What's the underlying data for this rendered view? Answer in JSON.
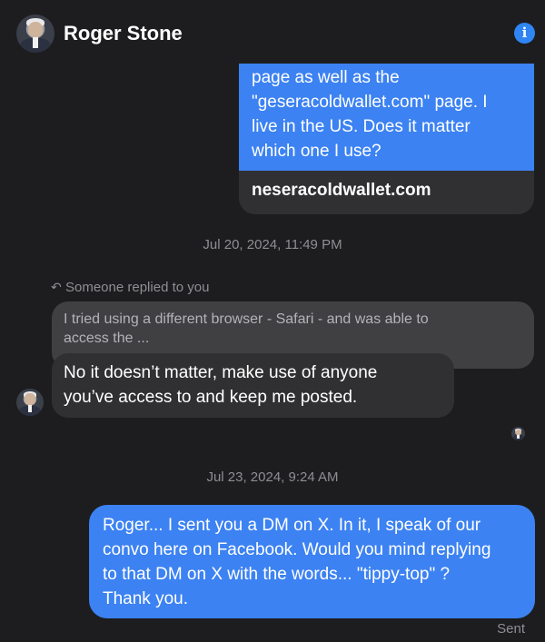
{
  "header": {
    "contact_name": "Roger Stone",
    "info_icon": "i"
  },
  "messages": {
    "top_bubble_text": "page as well as the\n\"geseracoldwallet.com\" page. I\nlive in the US. Does it matter\nwhich one I use?",
    "link_card_text": "neseracoldwallet.com",
    "timestamp_1": "Jul 20, 2024, 11:49 PM",
    "reply_label": "Someone replied to you",
    "quoted_text": "I tried using a different browser - Safari - and was able to\naccess the ...",
    "reply_text": "No it doesn’t matter, make use of anyone\nyou’ve access to and keep me posted.",
    "timestamp_2": "Jul 23, 2024, 9:24 AM",
    "last_text": "Roger... I sent you a DM on X. In it, I speak of our\nconvo here on Facebook. Would you mind replying\nto that DM on X with the words... \"tippy-top\" ?\nThank you.",
    "status": "Sent"
  },
  "colors": {
    "background": "#1d1d1f",
    "sent_bubble": "#3c82f2",
    "received_bubble": "#303032",
    "accent": "#2f85f2"
  }
}
